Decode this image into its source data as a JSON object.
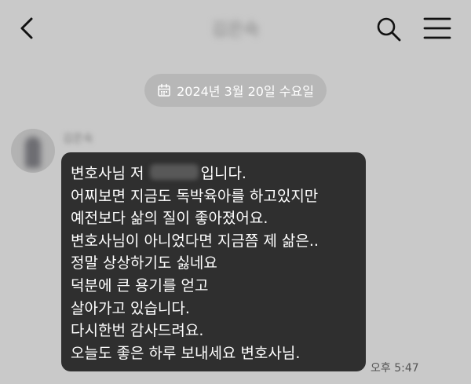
{
  "header": {
    "title": "김은숙",
    "back_icon": "chevron-left-icon",
    "search_icon": "search-icon",
    "menu_icon": "hamburger-menu-icon"
  },
  "date_divider": {
    "icon": "calendar-icon",
    "text": "2024년 3월 20일 수요일"
  },
  "message": {
    "sender_name": "김은숙",
    "lines": [
      "변호사님 저 ",
      "입니다.",
      "어찌보면 지금도 독박육아를 하고있지만",
      "예전보다 삶의 질이 좋아졌어요.",
      "변호사님이 아니었다면 지금쯤 제 삶은..",
      "정말 상상하기도 싫네요",
      "덕분에 큰 용기를 얻고",
      "살아가고 있습니다.",
      "다시한번 감사드려요.",
      "오늘도 좋은 하루 보내세요 변호사님."
    ],
    "time": "오후 5:47"
  },
  "colors": {
    "background": "#c9c9c9",
    "bubble": "#2f2f2f",
    "bubble_text": "#ffffff",
    "date_pill": "#b7b7b7"
  }
}
